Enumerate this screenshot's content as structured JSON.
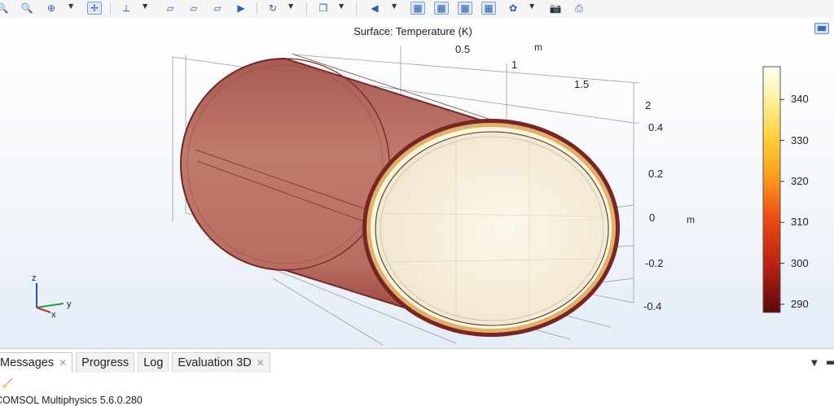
{
  "toolbar": {
    "buttons": [
      {
        "name": "zoom-out-icon",
        "glyph": "🔍"
      },
      {
        "name": "zoom-in-icon",
        "glyph": "🔍"
      },
      {
        "name": "zoom-box-icon",
        "glyph": "⊕"
      },
      {
        "name": "zoom-extents-icon",
        "glyph": "✛"
      },
      {
        "name": "view-axis-icon",
        "glyph": "⟂"
      },
      {
        "name": "go-to-xy-view-icon",
        "glyph": "▱"
      },
      {
        "name": "go-to-yz-view-icon",
        "glyph": "▱"
      },
      {
        "name": "go-to-zx-view-icon",
        "glyph": "▱"
      },
      {
        "name": "scene-light-icon",
        "glyph": "▶"
      },
      {
        "name": "reset-view-icon",
        "glyph": "↻"
      },
      {
        "name": "render-mode-icon",
        "glyph": "❒"
      },
      {
        "name": "lights-icon",
        "glyph": "◀"
      },
      {
        "name": "show-grid-icon",
        "glyph": "▦"
      },
      {
        "name": "show-axis-icon",
        "glyph": "▦"
      },
      {
        "name": "wireframe-icon",
        "glyph": "▦"
      },
      {
        "name": "transparency-icon",
        "glyph": "▦"
      },
      {
        "name": "settings-icon",
        "glyph": "✿"
      },
      {
        "name": "image-snapshot-icon",
        "glyph": "📷"
      },
      {
        "name": "print-icon",
        "glyph": "⎙"
      }
    ]
  },
  "plot": {
    "title": "Surface: Temperature (K)",
    "y_axis": {
      "ticks": [
        "0.5",
        "1",
        "1.5",
        "2"
      ],
      "unit": "m"
    },
    "z_axis": {
      "ticks": [
        "0.4",
        "0.2",
        "0",
        "-0.2",
        "-0.4"
      ],
      "unit": "m"
    },
    "triad": {
      "z": "z",
      "y": "y",
      "x": "x"
    },
    "colorbar": {
      "ticks": [
        "340",
        "330",
        "320",
        "310",
        "300",
        "290"
      ],
      "min": 288,
      "max": 348
    },
    "colors": {
      "hot": "#fffff2",
      "warm": "#ffd76a",
      "mid": "#ff9a20",
      "cool": "#d8341b",
      "cold": "#6e0e0e",
      "cylinder_body": "#b5695f",
      "cylinder_face": "#f7f0de"
    }
  },
  "panel": {
    "tabs": [
      {
        "label": "Messages",
        "closable": true
      },
      {
        "label": "Progress",
        "closable": false
      },
      {
        "label": "Log",
        "closable": false
      },
      {
        "label": "Evaluation 3D",
        "closable": true
      }
    ],
    "status_text": "COMSOL Multiphysics 5.6.0.280"
  }
}
